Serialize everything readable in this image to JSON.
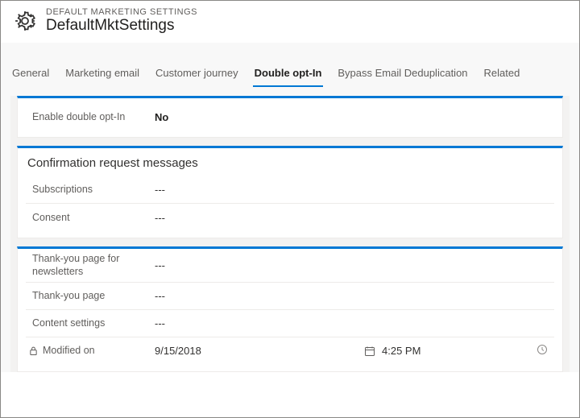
{
  "header": {
    "subtitle": "DEFAULT MARKETING SETTINGS",
    "title": "DefaultMktSettings"
  },
  "tabs": [
    {
      "label": "General",
      "active": false
    },
    {
      "label": "Marketing email",
      "active": false
    },
    {
      "label": "Customer journey",
      "active": false
    },
    {
      "label": "Double opt-In",
      "active": true
    },
    {
      "label": "Bypass Email Deduplication",
      "active": false
    },
    {
      "label": "Related",
      "active": false
    }
  ],
  "panelEnable": {
    "label": "Enable double opt-In",
    "value": "No"
  },
  "panelConfirm": {
    "title": "Confirmation request messages",
    "fields": [
      {
        "label": "Subscriptions",
        "value": "---"
      },
      {
        "label": "Consent",
        "value": "---"
      }
    ]
  },
  "panelThanks": {
    "fields": [
      {
        "label": "Thank-you page for newsletters",
        "value": "---"
      },
      {
        "label": "Thank-you page",
        "value": "---"
      },
      {
        "label": "Content settings",
        "value": "---"
      }
    ],
    "modified": {
      "label": "Modified on",
      "date": "9/15/2018",
      "time": "4:25 PM"
    }
  }
}
